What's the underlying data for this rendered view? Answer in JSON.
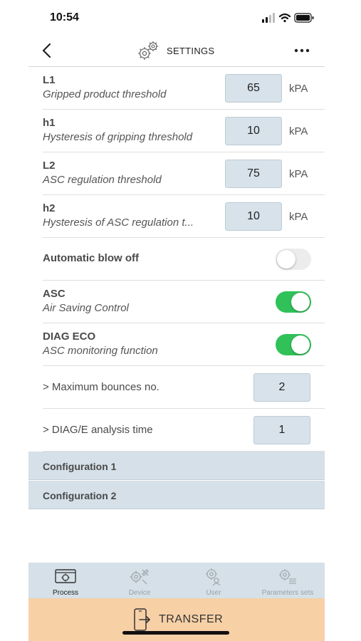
{
  "status": {
    "time": "10:54"
  },
  "nav": {
    "title": "SETTINGS",
    "back_icon": "chevron-left-icon",
    "more_icon": "more-horizontal-icon"
  },
  "parameters": [
    {
      "code": "L1",
      "description": "Gripped product threshold",
      "value": "65",
      "unit": "kPA"
    },
    {
      "code": "h1",
      "description": "Hysteresis of gripping threshold",
      "value": "10",
      "unit": "kPA"
    },
    {
      "code": "L2",
      "description": "ASC regulation threshold",
      "value": "75",
      "unit": "kPA"
    },
    {
      "code": "h2",
      "description": "Hysteresis of ASC regulation t...",
      "value": "10",
      "unit": "kPA"
    }
  ],
  "toggles": [
    {
      "title": "Automatic blow off",
      "on": false
    },
    {
      "title": "ASC",
      "description": "Air Saving Control",
      "on": true
    },
    {
      "title": "DIAG ECO",
      "description": "ASC monitoring function",
      "on": true
    }
  ],
  "sub_settings": [
    {
      "label": "> Maximum bounces no.",
      "value": "2"
    },
    {
      "label": "> DIAG/E analysis time",
      "value": "1"
    }
  ],
  "sections": [
    {
      "label": "Configuration 1"
    },
    {
      "label": "Configuration 2"
    }
  ],
  "tabs": [
    {
      "label": "Process",
      "active": true,
      "icon": "process-icon"
    },
    {
      "label": "Device",
      "active": false,
      "icon": "device-tools-icon"
    },
    {
      "label": "User",
      "active": false,
      "icon": "user-gear-icon"
    },
    {
      "label": "Parameters sets",
      "active": false,
      "icon": "parameters-sets-icon"
    }
  ],
  "transfer": {
    "label": "TRANSFER",
    "icon": "transfer-phone-icon"
  },
  "colors": {
    "toggle_on": "#30c159",
    "toggle_off": "#ececec",
    "section_bg": "#d5e0e8",
    "transfer_bg": "#f7d0a6",
    "input_bg": "#d7e2ea"
  }
}
